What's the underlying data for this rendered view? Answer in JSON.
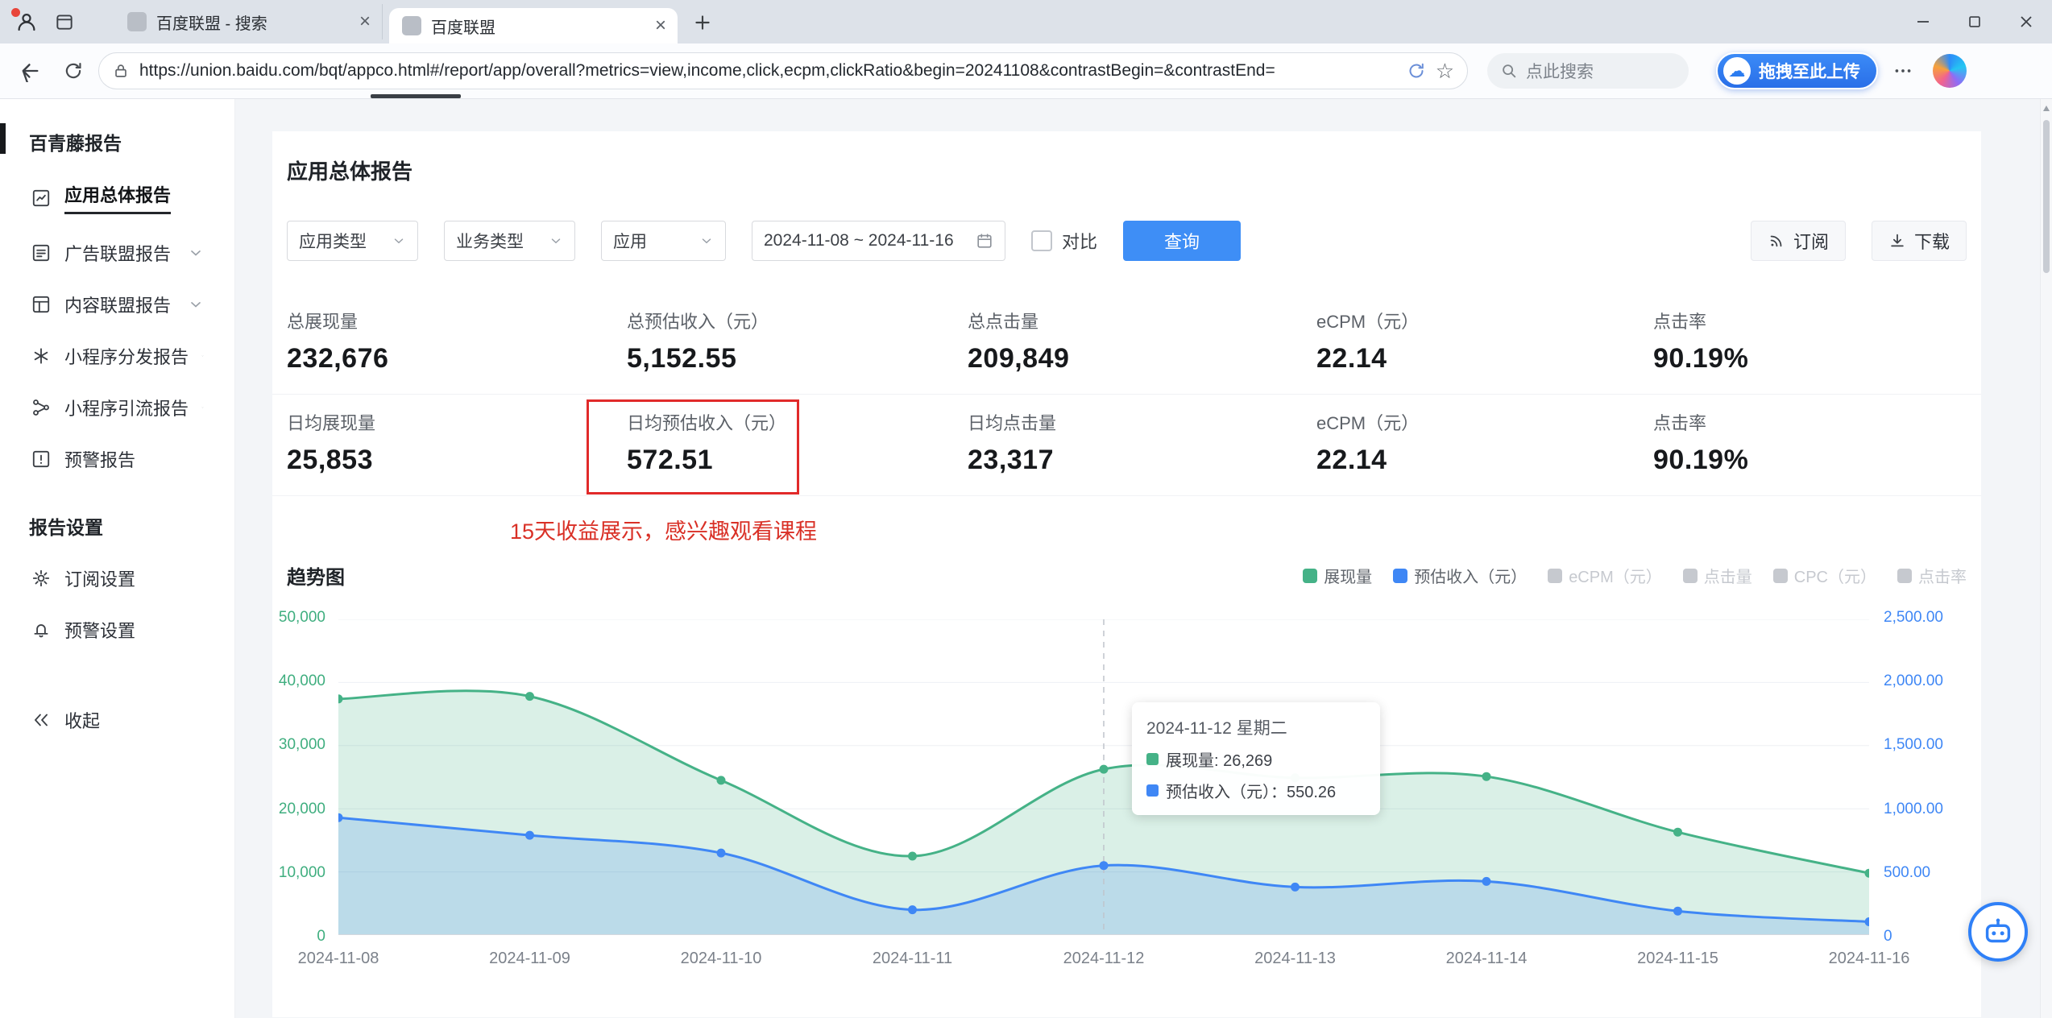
{
  "browser": {
    "tabs": [
      {
        "title": "百度联盟 - 搜索"
      },
      {
        "title": "百度联盟"
      }
    ],
    "url": "https://union.baidu.com/bqt/appco.html#/report/app/overall?metrics=view,income,click,ecpm,clickRatio&begin=20241108&contrastBegin=&contrastEnd=",
    "search_placeholder": "点此搜索",
    "upload_label": "拖拽至此上传"
  },
  "sidebar": {
    "section1": "百青藤报告",
    "items": [
      {
        "label": "应用总体报告",
        "active": true,
        "expandable": false
      },
      {
        "label": "广告联盟报告",
        "active": false,
        "expandable": true
      },
      {
        "label": "内容联盟报告",
        "active": false,
        "expandable": true
      },
      {
        "label": "小程序分发报告",
        "active": false,
        "expandable": true
      },
      {
        "label": "小程序引流报告",
        "active": false,
        "expandable": true
      },
      {
        "label": "预警报告",
        "active": false,
        "expandable": false
      }
    ],
    "section2": "报告设置",
    "settings": [
      {
        "label": "订阅设置"
      },
      {
        "label": "预警设置"
      }
    ],
    "collapse": "收起"
  },
  "report": {
    "title": "应用总体报告",
    "filters": {
      "app_type": "应用类型",
      "biz_type": "业务类型",
      "app": "应用",
      "date_range": "2024-11-08 ~ 2024-11-16",
      "compare": "对比",
      "query": "查询",
      "subscribe": "订阅",
      "download": "下载"
    },
    "stats_row1": [
      {
        "label": "总展现量",
        "value": "232,676"
      },
      {
        "label": "总预估收入（元）",
        "value": "5,152.55"
      },
      {
        "label": "总点击量",
        "value": "209,849"
      },
      {
        "label": "eCPM（元）",
        "value": "22.14"
      },
      {
        "label": "点击率",
        "value": "90.19%"
      }
    ],
    "stats_row2": [
      {
        "label": "日均展现量",
        "value": "25,853"
      },
      {
        "label": "日均预估收入（元）",
        "value": "572.51",
        "highlighted": true
      },
      {
        "label": "日均点击量",
        "value": "23,317"
      },
      {
        "label": "eCPM（元）",
        "value": "22.14"
      },
      {
        "label": "点击率",
        "value": "90.19%"
      }
    ],
    "annotation": "15天收益展示，感兴趣观看课程",
    "chart_title": "趋势图"
  },
  "chart_data": {
    "type": "area",
    "title": "趋势图",
    "x": [
      "2024-11-08",
      "2024-11-09",
      "2024-11-10",
      "2024-11-11",
      "2024-11-12",
      "2024-11-13",
      "2024-11-14",
      "2024-11-15",
      "2024-11-16"
    ],
    "series": [
      {
        "name": "展现量",
        "axis": "left",
        "color": "#45b287",
        "fill": "rgba(69,178,135,0.20)",
        "values": [
          37400,
          37800,
          24500,
          12500,
          26269,
          24900,
          25100,
          16300,
          9800
        ]
      },
      {
        "name": "预估收入（元）",
        "axis": "right",
        "color": "#3f87f5",
        "fill": "rgba(63,135,245,0.20)",
        "values": [
          930,
          790,
          650,
          200,
          550.26,
          380,
          425,
          190,
          105
        ]
      }
    ],
    "left_axis": {
      "min": 0,
      "max": 50000,
      "ticks": [
        "50,000",
        "40,000",
        "30,000",
        "20,000",
        "10,000",
        "0"
      ]
    },
    "right_axis": {
      "min": 0,
      "max": 2500,
      "ticks": [
        "2,500.00",
        "2,000.00",
        "1,500.00",
        "1,000.00",
        "500.00",
        "0"
      ]
    },
    "legend": [
      {
        "label": "展现量",
        "color": "#45b287",
        "label_color": "#5f646b",
        "active": true
      },
      {
        "label": "预估收入（元）",
        "color": "#3f87f5",
        "label_color": "#5f646b",
        "active": true
      },
      {
        "label": "eCPM（元）",
        "color": "#c6c9cf",
        "label_color": "#c6c9cf",
        "active": false
      },
      {
        "label": "点击量",
        "color": "#c6c9cf",
        "label_color": "#c6c9cf",
        "active": false
      },
      {
        "label": "CPC（元）",
        "color": "#c6c9cf",
        "label_color": "#c6c9cf",
        "active": false
      },
      {
        "label": "点击率",
        "color": "#c6c9cf",
        "label_color": "#c6c9cf",
        "active": false
      }
    ],
    "highlight_index": 4,
    "tooltip": {
      "title": "2024-11-12 星期二",
      "rows": [
        {
          "text": "展现量: 26,269",
          "color": "#45b287"
        },
        {
          "text": "预估收入（元）：550.26",
          "color": "#3f87f5"
        }
      ]
    },
    "grid": true,
    "legend_position": "top-right"
  }
}
